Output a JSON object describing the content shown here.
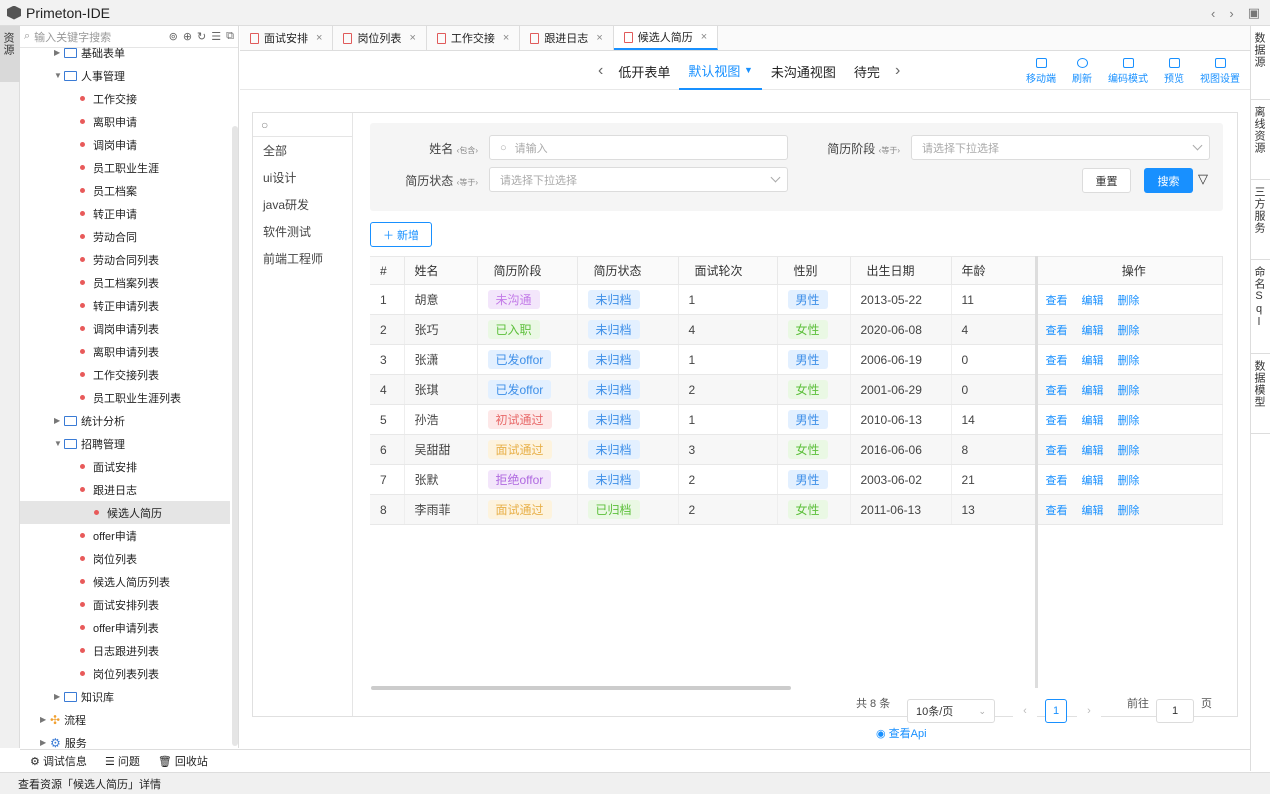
{
  "app": {
    "title": "Primeton-IDE"
  },
  "left_sidebar": {
    "label": "资源"
  },
  "right_sidebar": [
    "数据源",
    "离线资源",
    "三方服务",
    "命名Sql",
    "数据模型"
  ],
  "tree": {
    "search_placeholder": "输入关键字搜索",
    "nodes": [
      {
        "label": "基础表单",
        "type": "folder",
        "level": 2,
        "expanded": false
      },
      {
        "label": "人事管理",
        "type": "folder",
        "level": 2,
        "expanded": true
      },
      {
        "label": "工作交接",
        "type": "page",
        "level": 3
      },
      {
        "label": "离职申请",
        "type": "page",
        "level": 3
      },
      {
        "label": "调岗申请",
        "type": "page",
        "level": 3
      },
      {
        "label": "员工职业生涯",
        "type": "page",
        "level": 3
      },
      {
        "label": "员工档案",
        "type": "page",
        "level": 3
      },
      {
        "label": "转正申请",
        "type": "page",
        "level": 3
      },
      {
        "label": "劳动合同",
        "type": "page",
        "level": 3
      },
      {
        "label": "劳动合同列表",
        "type": "page",
        "level": 3
      },
      {
        "label": "员工档案列表",
        "type": "page",
        "level": 3
      },
      {
        "label": "转正申请列表",
        "type": "page",
        "level": 3
      },
      {
        "label": "调岗申请列表",
        "type": "page",
        "level": 3
      },
      {
        "label": "离职申请列表",
        "type": "page",
        "level": 3
      },
      {
        "label": "工作交接列表",
        "type": "page",
        "level": 3
      },
      {
        "label": "员工职业生涯列表",
        "type": "page",
        "level": 3
      },
      {
        "label": "统计分析",
        "type": "folder",
        "level": 2,
        "expanded": false
      },
      {
        "label": "招聘管理",
        "type": "folder",
        "level": 2,
        "expanded": true
      },
      {
        "label": "面试安排",
        "type": "page",
        "level": 3
      },
      {
        "label": "跟进日志",
        "type": "page",
        "level": 3
      },
      {
        "label": "候选人简历",
        "type": "page",
        "level": 3,
        "selected": true
      },
      {
        "label": "offer申请",
        "type": "page",
        "level": 3
      },
      {
        "label": "岗位列表",
        "type": "page",
        "level": 3
      },
      {
        "label": "候选人简历列表",
        "type": "page",
        "level": 3
      },
      {
        "label": "面试安排列表",
        "type": "page",
        "level": 3
      },
      {
        "label": "offer申请列表",
        "type": "page",
        "level": 3
      },
      {
        "label": "日志跟进列表",
        "type": "page",
        "level": 3
      },
      {
        "label": "岗位列表列表",
        "type": "page",
        "level": 3
      },
      {
        "label": "知识库",
        "type": "folder",
        "level": 2,
        "expanded": false
      },
      {
        "label": "流程",
        "type": "flow",
        "level": 1,
        "expanded": false
      },
      {
        "label": "服务",
        "type": "service",
        "level": 1,
        "expanded": false
      }
    ]
  },
  "tabs": [
    {
      "label": "面试安排",
      "active": false
    },
    {
      "label": "岗位列表",
      "active": false
    },
    {
      "label": "工作交接",
      "active": false
    },
    {
      "label": "跟进日志",
      "active": false
    },
    {
      "label": "候选人简历",
      "active": true
    }
  ],
  "views": {
    "items": [
      "低开表单",
      "默认视图",
      "未沟通视图",
      "待完"
    ],
    "active": "默认视图"
  },
  "view_tools": [
    "移动端",
    "刷新",
    "编码模式",
    "预览",
    "视图设置"
  ],
  "categories": [
    "全部",
    "ui设计",
    "java研发",
    "软件测试",
    "前端工程师"
  ],
  "filter": {
    "name_label": "姓名",
    "name_op": "包含",
    "name_placeholder": "请输入",
    "stage_label": "简历阶段",
    "stage_op": "等于",
    "stage_placeholder": "请选择下拉选择",
    "status_label": "简历状态",
    "status_op": "等于",
    "status_placeholder": "请选择下拉选择",
    "reset": "重置",
    "search": "搜索"
  },
  "add_button": "新增",
  "table": {
    "headers": [
      "#",
      "姓名",
      "简历阶段",
      "简历状态",
      "面试轮次",
      "性别",
      "出生日期",
      "年龄",
      "操作"
    ],
    "rows": [
      {
        "no": "1",
        "name": "胡意",
        "stage": "未沟通",
        "status": "未归档",
        "round": "1",
        "gender": "男性",
        "birth": "2013-05-22",
        "age": "11"
      },
      {
        "no": "2",
        "name": "张巧",
        "stage": "已入职",
        "status": "未归档",
        "round": "4",
        "gender": "女性",
        "birth": "2020-06-08",
        "age": "4"
      },
      {
        "no": "3",
        "name": "张潇",
        "stage": "已发offor",
        "status": "未归档",
        "round": "1",
        "gender": "男性",
        "birth": "2006-06-19",
        "age": "0"
      },
      {
        "no": "4",
        "name": "张琪",
        "stage": "已发offor",
        "status": "未归档",
        "round": "2",
        "gender": "女性",
        "birth": "2001-06-29",
        "age": "0"
      },
      {
        "no": "5",
        "name": "孙浩",
        "stage": "初试通过",
        "status": "未归档",
        "round": "1",
        "gender": "男性",
        "birth": "2010-06-13",
        "age": "14"
      },
      {
        "no": "6",
        "name": "吴甜甜",
        "stage": "面试通过",
        "status": "未归档",
        "round": "3",
        "gender": "女性",
        "birth": "2016-06-06",
        "age": "8"
      },
      {
        "no": "7",
        "name": "张默",
        "stage": "拒绝offor",
        "status": "未归档",
        "round": "2",
        "gender": "男性",
        "birth": "2003-06-02",
        "age": "21"
      },
      {
        "no": "8",
        "name": "李雨菲",
        "stage": "面试通过",
        "status": "已归档",
        "round": "2",
        "gender": "女性",
        "birth": "2011-06-13",
        "age": "13"
      }
    ],
    "ops": [
      "查看",
      "编辑",
      "删除"
    ]
  },
  "tag_colors": {
    "未沟通": {
      "bg": "#f3e6fb",
      "fg": "#c37be8"
    },
    "已入职": {
      "bg": "#eaf8e4",
      "fg": "#5cbf3a"
    },
    "已发offor": {
      "bg": "#e3f0ff",
      "fg": "#3e8fe8"
    },
    "初试通过": {
      "bg": "#fde8e8",
      "fg": "#e86a6a"
    },
    "面试通过": {
      "bg": "#fdf3de",
      "fg": "#e8b04a"
    },
    "拒绝offor": {
      "bg": "#f3e6fb",
      "fg": "#b06ae0"
    },
    "未归档": {
      "bg": "#e3f0ff",
      "fg": "#3e8fe8"
    },
    "已归档": {
      "bg": "#eaf8e4",
      "fg": "#5cbf3a"
    },
    "男性": {
      "bg": "#e3f0ff",
      "fg": "#3e8fe8"
    },
    "女性": {
      "bg": "#eaf8e4",
      "fg": "#5cbf3a"
    }
  },
  "pagination": {
    "total": "共 8 条",
    "page_size": "10条/页",
    "current": "1",
    "goto": "前往",
    "goto_value": "1",
    "page_unit": "页"
  },
  "api_link": "查看Api",
  "bottom_tools": [
    "调试信息",
    "问题",
    "回收站"
  ],
  "status": "查看资源「候选人简历」详情"
}
